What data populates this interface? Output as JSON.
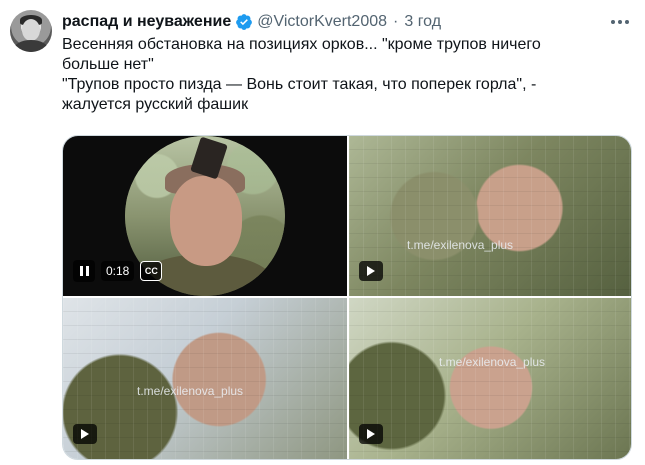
{
  "tweet": {
    "author_name": "распад и неуважение",
    "handle": "@VictorKvert2008",
    "separator": "·",
    "time": "3 год",
    "lines": [
      "Весенняя обстановка на позициях орков... \"кроме трупов ничего",
      "больше нет\"",
      "\"Трупов просто пизда — Вонь стоит такая, что поперек горла\", -",
      "жалуется русский фашик"
    ]
  },
  "media": {
    "video_time": "0:18",
    "captions_label": "CC",
    "watermark": "t.me/exilenova_plus"
  },
  "colors": {
    "verified": "#1d9bf0",
    "text": "#0f1419",
    "secondary": "#536471"
  }
}
